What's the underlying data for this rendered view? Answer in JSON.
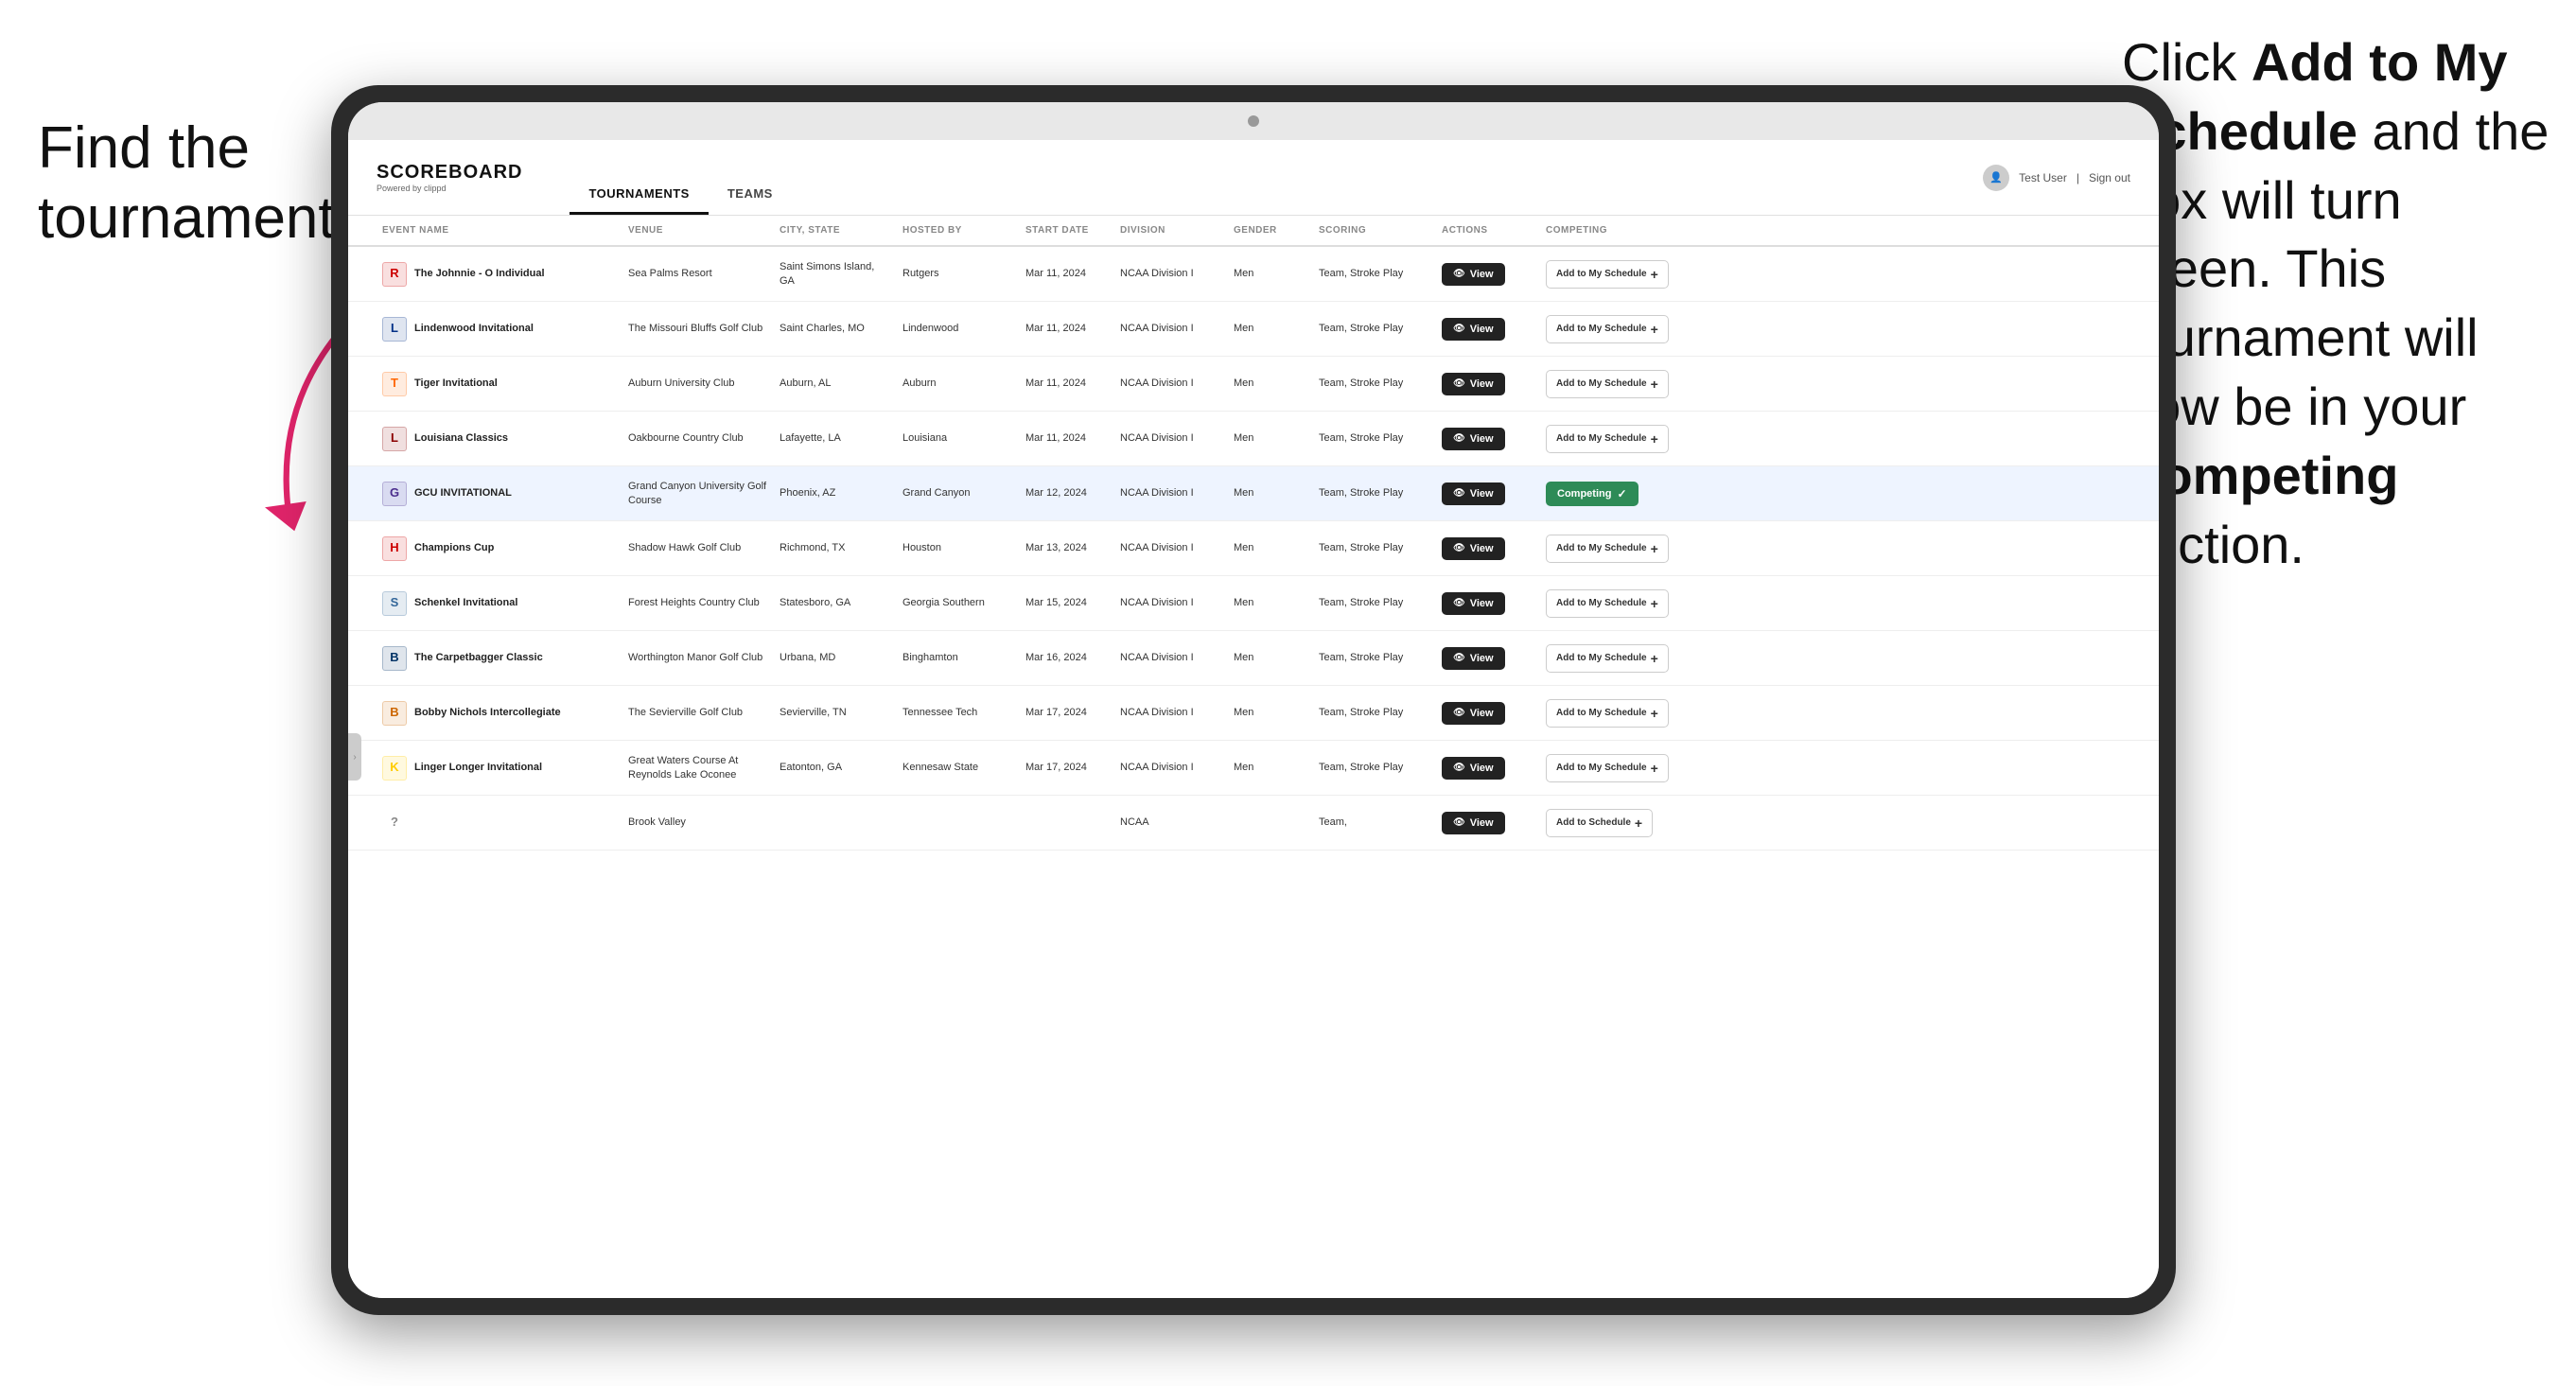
{
  "annotations": {
    "left_text_line1": "Find the",
    "left_text_line2": "tournament.",
    "right_text": "Click ",
    "right_text_bold1": "Add to My Schedule",
    "right_text_mid": " and the box will turn green. This tournament will now be in your ",
    "right_text_bold2": "Competing",
    "right_text_end": " section."
  },
  "nav": {
    "logo": "SCOREBOARD",
    "logo_sub": "Powered by clippd",
    "tabs": [
      "TOURNAMENTS",
      "TEAMS"
    ],
    "active_tab": "TOURNAMENTS",
    "user": "Test User",
    "sign_out": "Sign out"
  },
  "table": {
    "headers": [
      "EVENT NAME",
      "VENUE",
      "CITY, STATE",
      "HOSTED BY",
      "START DATE",
      "DIVISION",
      "GENDER",
      "SCORING",
      "ACTIONS",
      "COMPETING"
    ],
    "rows": [
      {
        "logo_text": "R",
        "logo_color": "#cc0000",
        "event_name": "The Johnnie - O Individual",
        "venue": "Sea Palms Resort",
        "city_state": "Saint Simons Island, GA",
        "hosted_by": "Rutgers",
        "start_date": "Mar 11, 2024",
        "division": "NCAA Division I",
        "gender": "Men",
        "scoring": "Team, Stroke Play",
        "action": "View",
        "competing": "Add to My Schedule",
        "is_competing": false,
        "highlighted": false
      },
      {
        "logo_text": "L",
        "logo_color": "#003087",
        "event_name": "Lindenwood Invitational",
        "venue": "The Missouri Bluffs Golf Club",
        "city_state": "Saint Charles, MO",
        "hosted_by": "Lindenwood",
        "start_date": "Mar 11, 2024",
        "division": "NCAA Division I",
        "gender": "Men",
        "scoring": "Team, Stroke Play",
        "action": "View",
        "competing": "Add to My Schedule",
        "is_competing": false,
        "highlighted": false
      },
      {
        "logo_text": "T",
        "logo_color": "#ff6600",
        "event_name": "Tiger Invitational",
        "venue": "Auburn University Club",
        "city_state": "Auburn, AL",
        "hosted_by": "Auburn",
        "start_date": "Mar 11, 2024",
        "division": "NCAA Division I",
        "gender": "Men",
        "scoring": "Team, Stroke Play",
        "action": "View",
        "competing": "Add to My Schedule",
        "is_competing": false,
        "highlighted": false
      },
      {
        "logo_text": "L",
        "logo_color": "#8b0000",
        "event_name": "Louisiana Classics",
        "venue": "Oakbourne Country Club",
        "city_state": "Lafayette, LA",
        "hosted_by": "Louisiana",
        "start_date": "Mar 11, 2024",
        "division": "NCAA Division I",
        "gender": "Men",
        "scoring": "Team, Stroke Play",
        "action": "View",
        "competing": "Add to My Schedule",
        "is_competing": false,
        "highlighted": false
      },
      {
        "logo_text": "G",
        "logo_color": "#4a2c8c",
        "event_name": "GCU INVITATIONAL",
        "venue": "Grand Canyon University Golf Course",
        "city_state": "Phoenix, AZ",
        "hosted_by": "Grand Canyon",
        "start_date": "Mar 12, 2024",
        "division": "NCAA Division I",
        "gender": "Men",
        "scoring": "Team, Stroke Play",
        "action": "View",
        "competing": "Competing",
        "is_competing": true,
        "highlighted": true
      },
      {
        "logo_text": "H",
        "logo_color": "#cc0000",
        "event_name": "Champions Cup",
        "venue": "Shadow Hawk Golf Club",
        "city_state": "Richmond, TX",
        "hosted_by": "Houston",
        "start_date": "Mar 13, 2024",
        "division": "NCAA Division I",
        "gender": "Men",
        "scoring": "Team, Stroke Play",
        "action": "View",
        "competing": "Add to My Schedule",
        "is_competing": false,
        "highlighted": false
      },
      {
        "logo_text": "S",
        "logo_color": "#336699",
        "event_name": "Schenkel Invitational",
        "venue": "Forest Heights Country Club",
        "city_state": "Statesboro, GA",
        "hosted_by": "Georgia Southern",
        "start_date": "Mar 15, 2024",
        "division": "NCAA Division I",
        "gender": "Men",
        "scoring": "Team, Stroke Play",
        "action": "View",
        "competing": "Add to My Schedule",
        "is_competing": false,
        "highlighted": false
      },
      {
        "logo_text": "B",
        "logo_color": "#003366",
        "event_name": "The Carpetbagger Classic",
        "venue": "Worthington Manor Golf Club",
        "city_state": "Urbana, MD",
        "hosted_by": "Binghamton",
        "start_date": "Mar 16, 2024",
        "division": "NCAA Division I",
        "gender": "Men",
        "scoring": "Team, Stroke Play",
        "action": "View",
        "competing": "Add to My Schedule",
        "is_competing": false,
        "highlighted": false
      },
      {
        "logo_text": "B",
        "logo_color": "#cc6600",
        "event_name": "Bobby Nichols Intercollegiate",
        "venue": "The Sevierville Golf Club",
        "city_state": "Sevierville, TN",
        "hosted_by": "Tennessee Tech",
        "start_date": "Mar 17, 2024",
        "division": "NCAA Division I",
        "gender": "Men",
        "scoring": "Team, Stroke Play",
        "action": "View",
        "competing": "Add to My Schedule",
        "is_competing": false,
        "highlighted": false
      },
      {
        "logo_text": "K",
        "logo_color": "#ffcc00",
        "event_name": "Linger Longer Invitational",
        "venue": "Great Waters Course At Reynolds Lake Oconee",
        "city_state": "Eatonton, GA",
        "hosted_by": "Kennesaw State",
        "start_date": "Mar 17, 2024",
        "division": "NCAA Division I",
        "gender": "Men",
        "scoring": "Team, Stroke Play",
        "action": "View",
        "competing": "Add to My Schedule",
        "is_competing": false,
        "highlighted": false
      },
      {
        "logo_text": "?",
        "logo_color": "#888",
        "event_name": "",
        "venue": "Brook Valley",
        "city_state": "",
        "hosted_by": "",
        "start_date": "",
        "division": "NCAA",
        "gender": "",
        "scoring": "Team,",
        "action": "View",
        "competing": "Add to Schedule",
        "is_competing": false,
        "highlighted": false
      }
    ]
  },
  "buttons": {
    "view_label": "View",
    "add_schedule_label": "Add to My Schedule",
    "competing_label": "Competing",
    "add_label": "Add to Schedule"
  }
}
